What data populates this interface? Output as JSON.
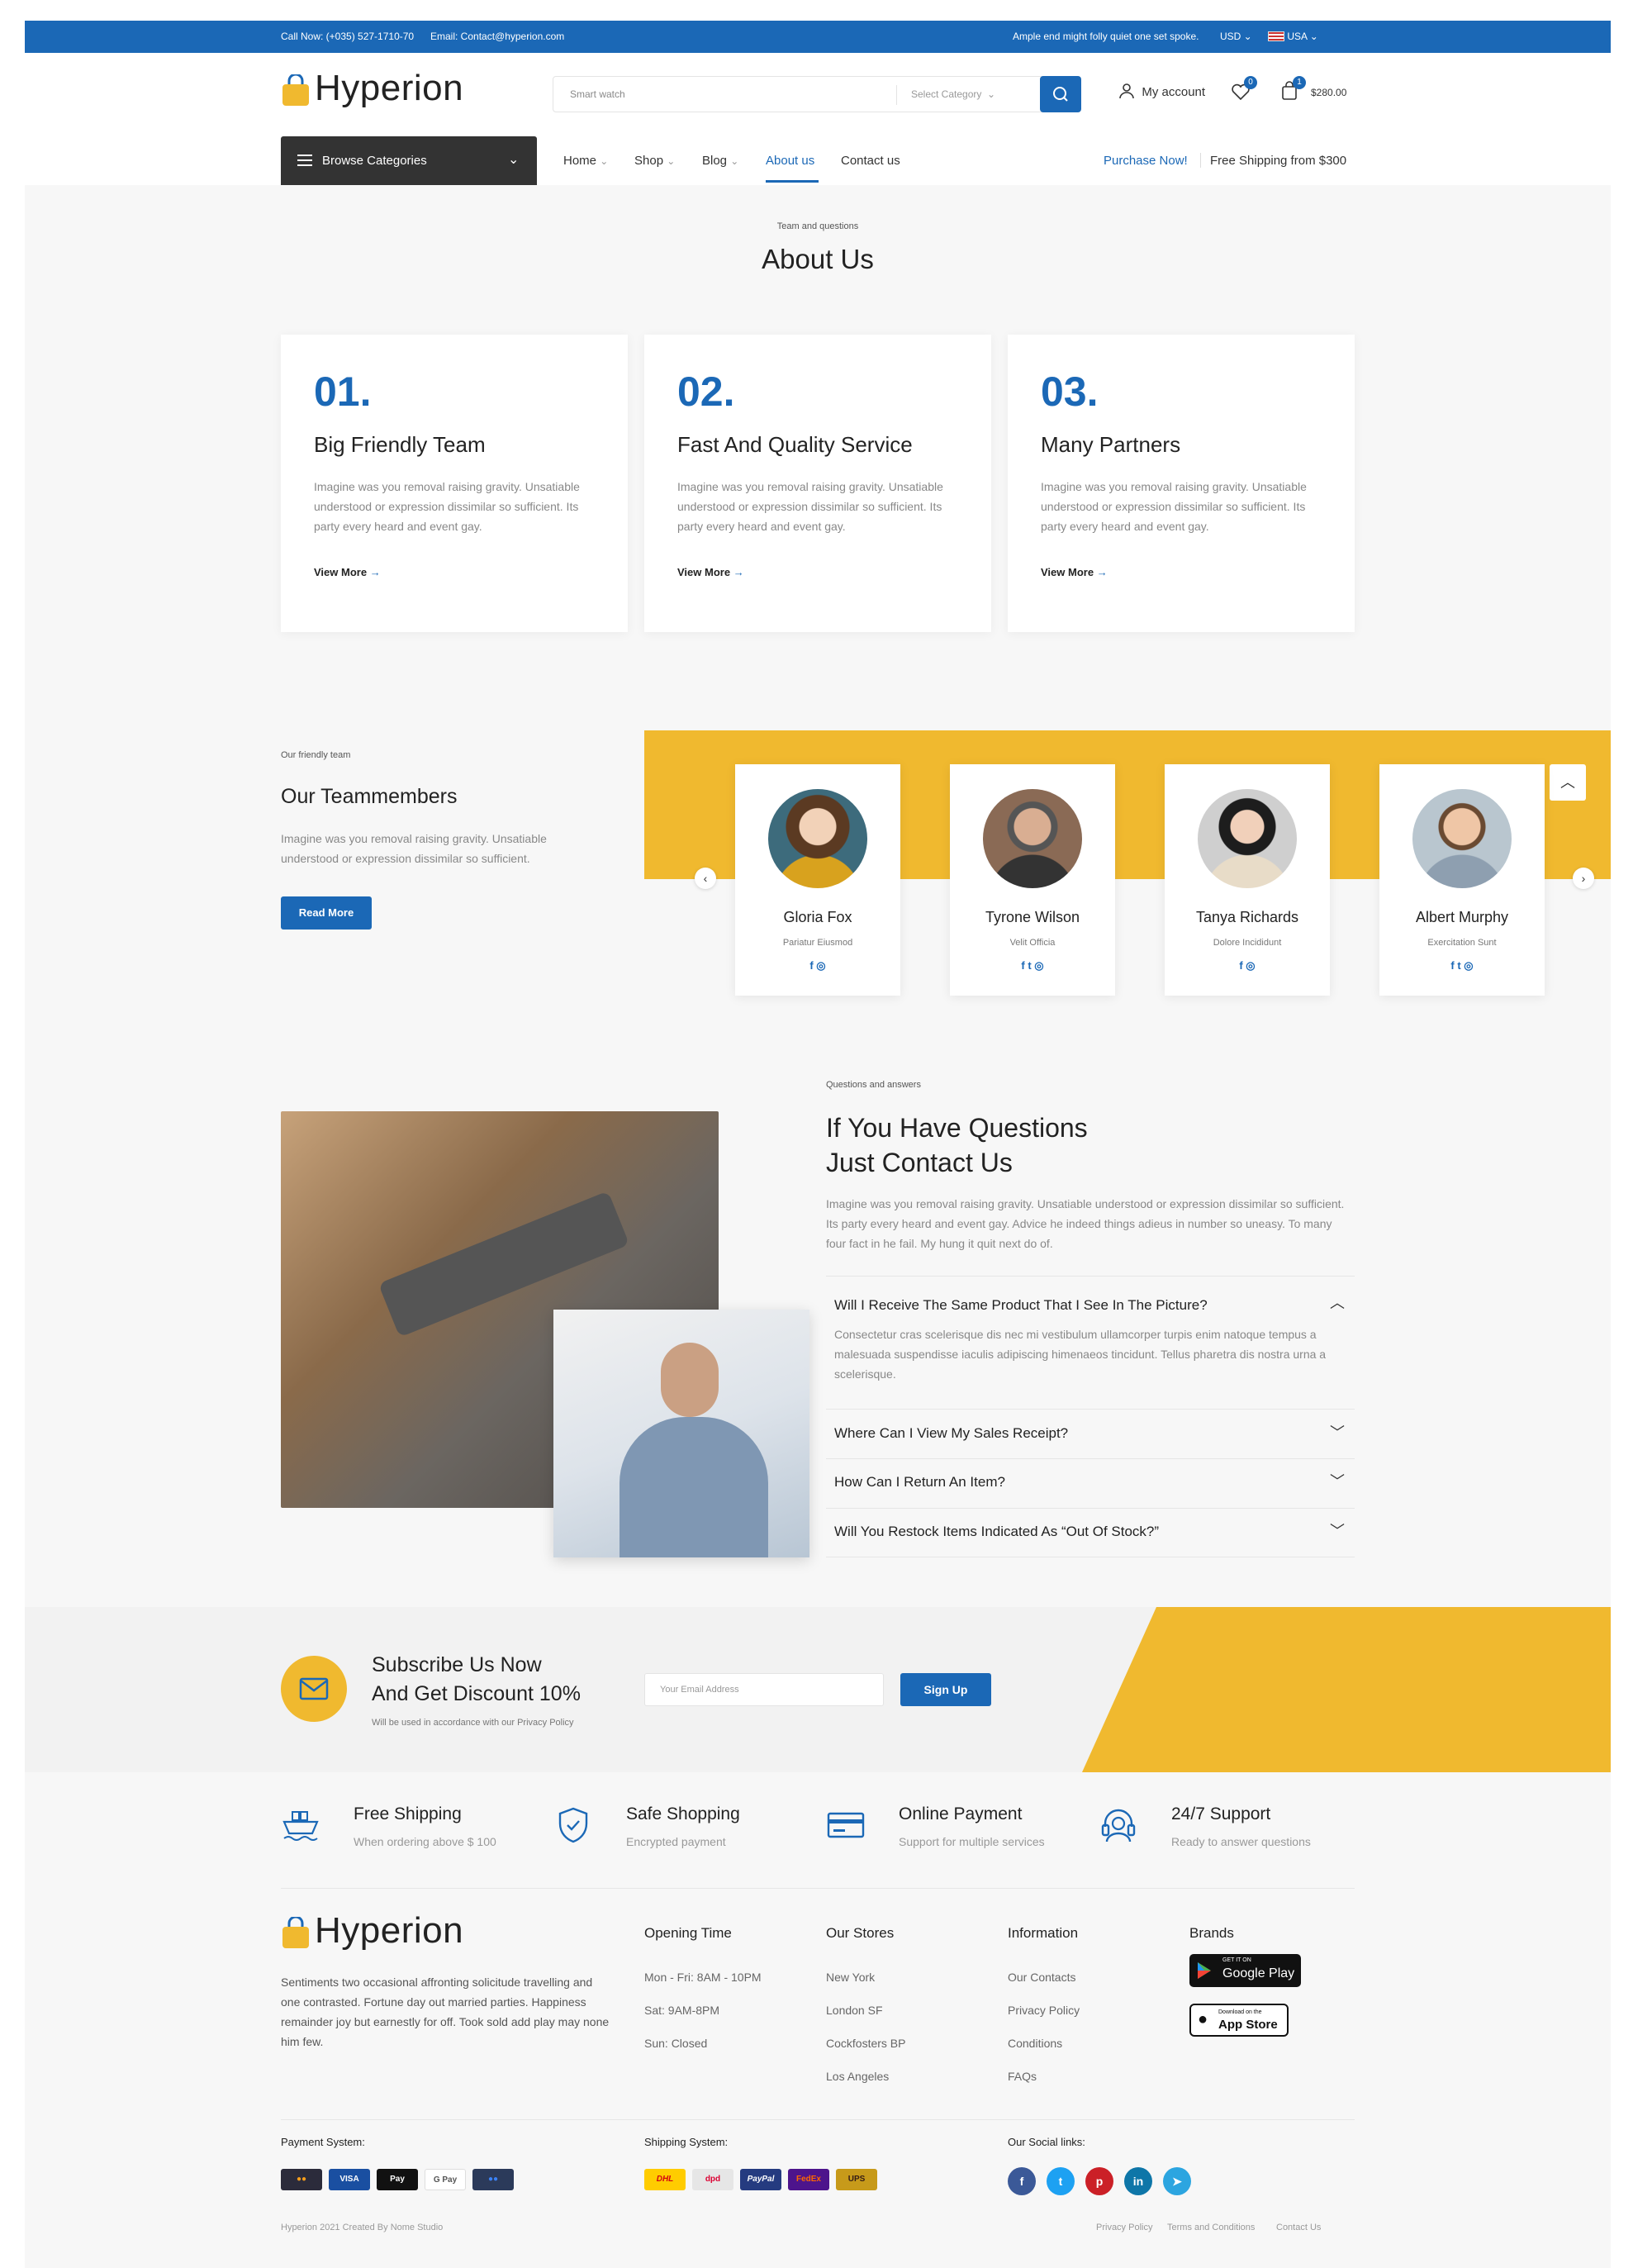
{
  "topbar": {
    "phone": "Call Now: (+035) 527-1710-70",
    "email": "Email: Contact@hyperion.com",
    "tagline": "Ample end might folly quiet one set spoke.",
    "currency": "USD",
    "country": "USA"
  },
  "header": {
    "brand": "Hyperion",
    "search_placeholder": "Smart watch",
    "category_select": "Select Category",
    "account_label": "My account",
    "wishlist_count": "0",
    "cart_count": "1",
    "cart_total": "$280.00"
  },
  "nav": {
    "browse": "Browse Categories",
    "items": [
      "Home",
      "Shop",
      "Blog",
      "About us",
      "Contact us"
    ],
    "active": "About us",
    "purchase": "Purchase Now!",
    "shipping": "Free Shipping from $300"
  },
  "about": {
    "eyebrow": "Team and questions",
    "title": "About Us",
    "cards": [
      {
        "num": "01.",
        "title": "Big Friendly Team",
        "text": "Imagine was you removal raising gravity. Unsatiable understood or expression dissimilar so sufficient. Its party every heard and event gay.",
        "link": "View More"
      },
      {
        "num": "02.",
        "title": "Fast And Quality Service",
        "text": "Imagine was you removal raising gravity. Unsatiable understood or expression dissimilar so sufficient. Its party every heard and event gay.",
        "link": "View More"
      },
      {
        "num": "03.",
        "title": "Many Partners",
        "text": "Imagine was you removal raising gravity. Unsatiable understood or expression dissimilar so sufficient. Its party every heard and event gay.",
        "link": "View More"
      }
    ]
  },
  "team": {
    "eyebrow": "Our friendly team",
    "title": "Our Teammembers",
    "text": "Imagine was you removal raising gravity. Unsatiable understood or expression dissimilar so sufficient.",
    "button": "Read More",
    "members": [
      {
        "name": "Gloria Fox",
        "role": "Pariatur Eiusmod",
        "socials": "f  ◎"
      },
      {
        "name": "Tyrone Wilson",
        "role": "Velit Officia",
        "socials": "f  t  ◎"
      },
      {
        "name": "Tanya Richards",
        "role": "Dolore Incididunt",
        "socials": "f  ◎"
      },
      {
        "name": "Albert Murphy",
        "role": "Exercitation Sunt",
        "socials": "f  t  ◎"
      }
    ]
  },
  "faq": {
    "eyebrow": "Questions and answers",
    "title_line1": "If You Have Questions",
    "title_line2": "Just Contact Us",
    "intro": "Imagine was you removal raising gravity. Unsatiable understood or expression dissimilar so sufficient. Its party every heard and event gay. Advice he indeed things adieus in number so uneasy. To many four fact in he fail. My hung it quit next do of.",
    "items": [
      {
        "q": "Will I Receive The Same Product That I See In The Picture?",
        "a": "Consectetur cras scelerisque dis nec mi vestibulum ullamcorper turpis enim natoque tempus a malesuada suspendisse iaculis adipiscing himenaeos tincidunt. Tellus pharetra dis nostra urna a scelerisque.",
        "open": true
      },
      {
        "q": "Where Can I View My Sales Receipt?",
        "open": false
      },
      {
        "q": "How Can I Return An Item?",
        "open": false
      },
      {
        "q": "Will You Restock Items Indicated As “Out Of Stock?”",
        "open": false
      }
    ]
  },
  "subscribe": {
    "title_line1": "Subscribe Us Now",
    "title_line2": "And Get Discount 10%",
    "note": "Will be used in accordance with our Privacy Policy",
    "placeholder": "Your Email Address",
    "button": "Sign Up"
  },
  "features": [
    {
      "title": "Free Shipping",
      "sub": "When ordering above $ 100",
      "icon": "ship-icon"
    },
    {
      "title": "Safe Shopping",
      "sub": "Encrypted payment",
      "icon": "shield-icon"
    },
    {
      "title": "Online Payment",
      "sub": "Support for multiple services",
      "icon": "card-icon"
    },
    {
      "title": "24/7 Support",
      "sub": "Ready to answer questions",
      "icon": "headset-icon"
    }
  ],
  "footer": {
    "brand": "Hyperion",
    "about": "Sentiments two occasional affronting solicitude travelling and one contrasted. Fortune day out married parties. Happiness remainder joy but earnestly for off. Took sold add play may none him few.",
    "hours": {
      "title": "Opening Time",
      "lines": [
        "Mon - Fri: 8AM - 10PM",
        "Sat: 9AM-8PM",
        "Sun: Closed"
      ]
    },
    "stores": {
      "title": "Our Stores",
      "lines": [
        "New York",
        "London SF",
        "Cockfosters BP",
        "Los Angeles"
      ]
    },
    "info": {
      "title": "Information",
      "lines": [
        "Our Contacts",
        "Privacy Policy",
        "Conditions",
        "FAQs"
      ]
    },
    "brands": {
      "title": "Brands",
      "google_small": "GET IT ON",
      "google": "Google Play",
      "apple_small": "Download on the",
      "apple": "App Store"
    },
    "payment_title": "Payment System:",
    "payment": [
      "●●",
      "VISA",
      "Pay",
      "G Pay",
      "●●"
    ],
    "shipping_title": "Shipping System:",
    "shipping": [
      "DHL",
      "dpd",
      "PayPal",
      "FedEx",
      "UPS"
    ],
    "social_title": "Our Social links:",
    "social": [
      "f",
      "t",
      "p",
      "in",
      "➤"
    ],
    "copyright": "Hyperion 2021 Created By Nome Studio",
    "bottom_links": [
      "Privacy Policy",
      "Terms and Conditions",
      "Contact Us"
    ]
  },
  "colors": {
    "primary": "#1b68b6",
    "accent": "#f0b92f",
    "dark": "#333333"
  }
}
